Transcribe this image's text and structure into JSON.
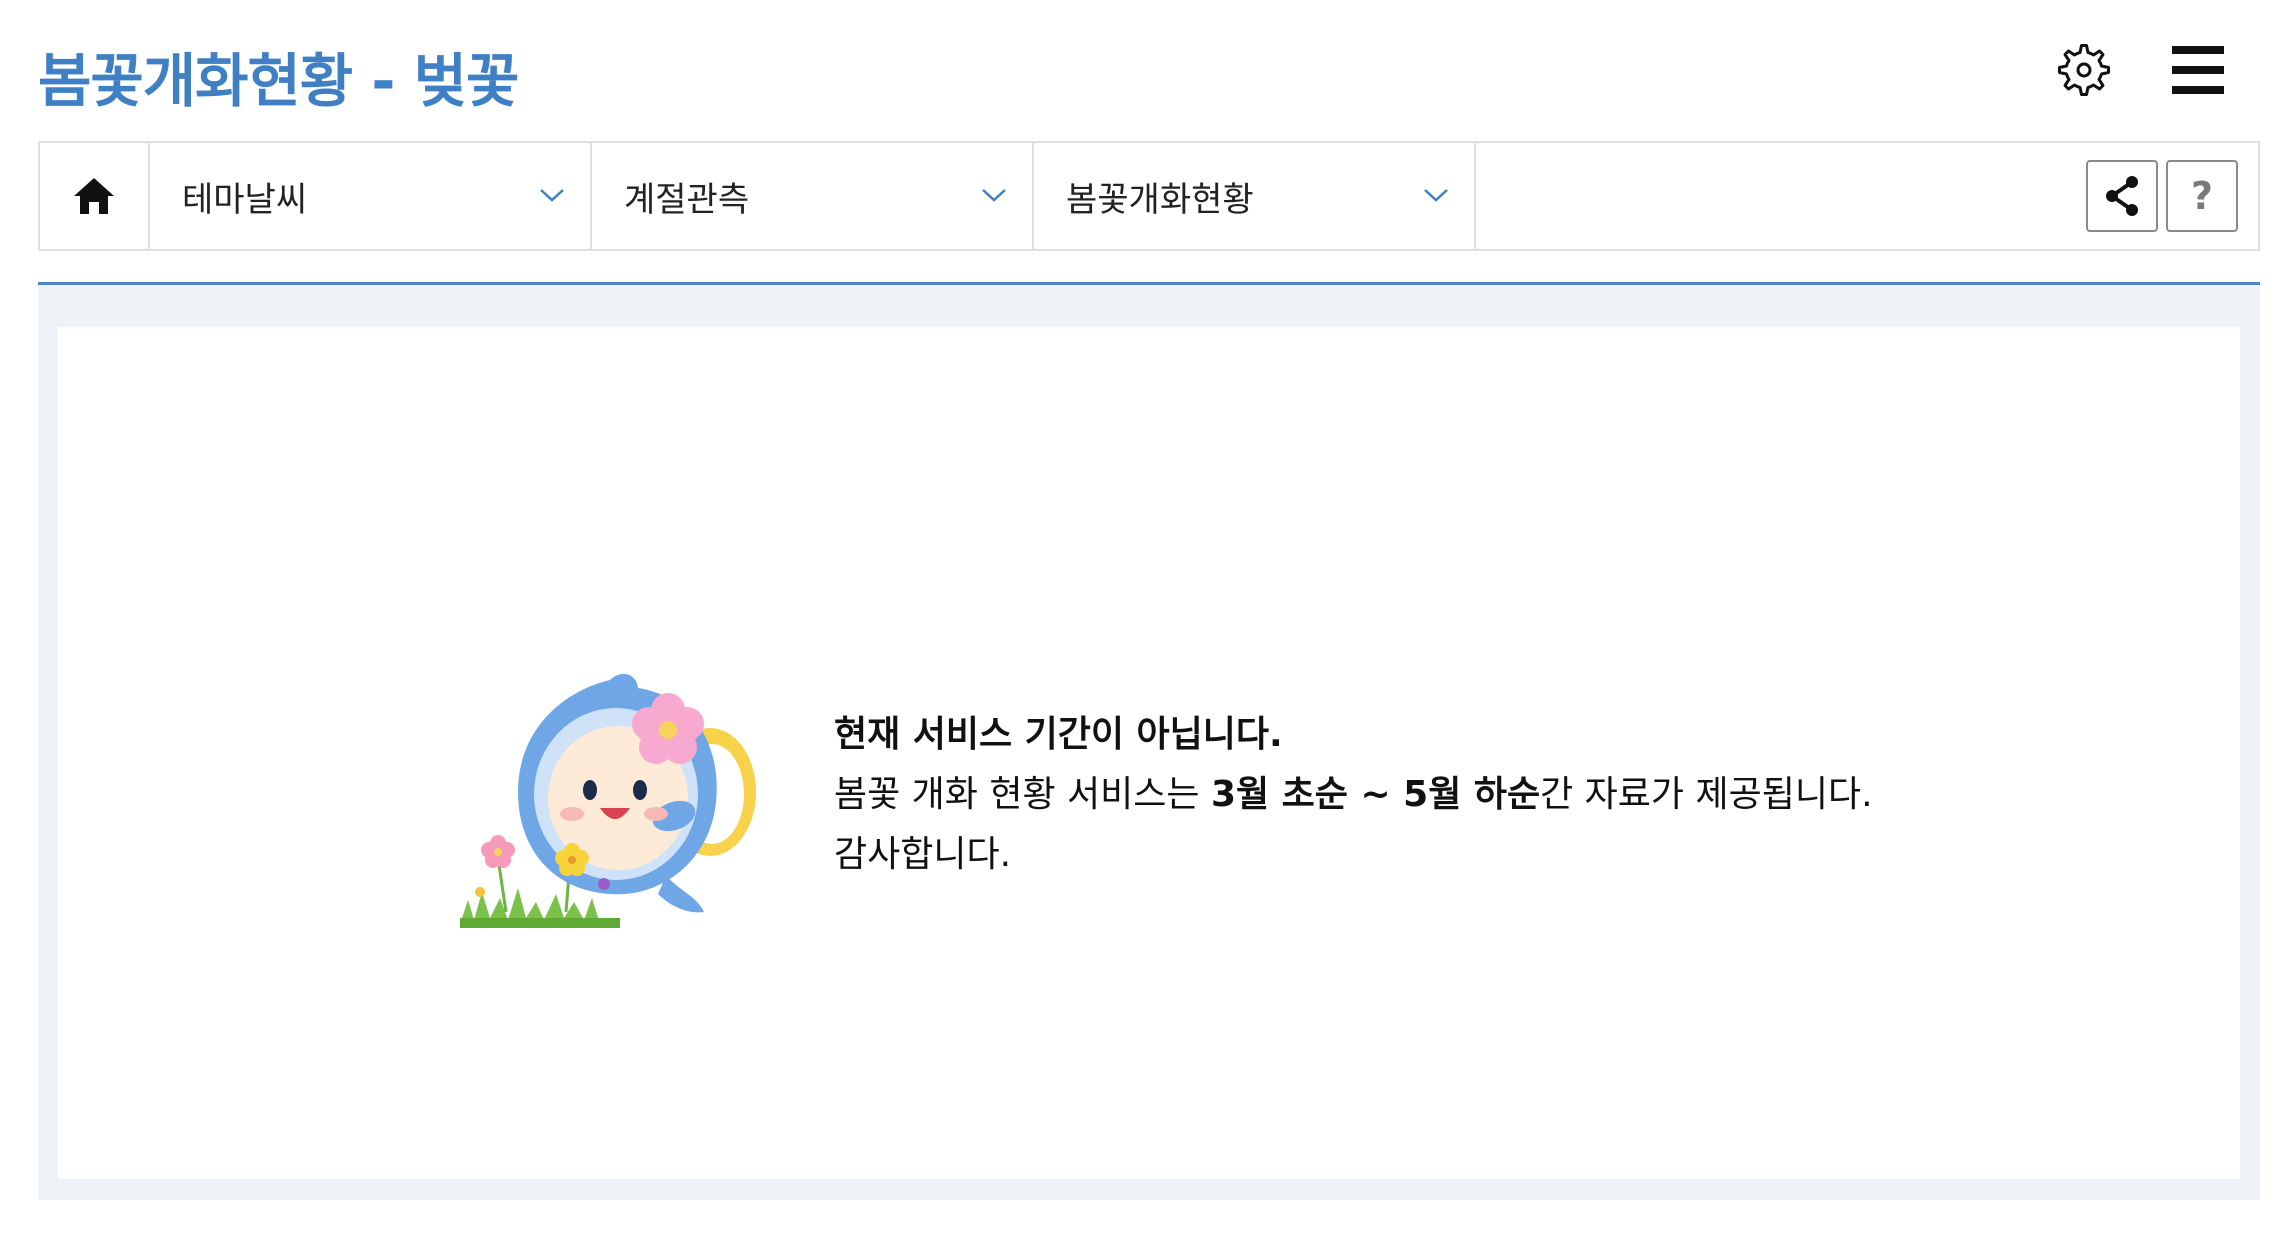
{
  "header": {
    "title": "봄꽃개화현황 - 벚꽃",
    "settings_icon": "gear-icon",
    "menu_icon": "hamburger-menu-icon",
    "title_color": "#3f7fc4"
  },
  "nav": {
    "home_icon": "home-icon",
    "selects": [
      {
        "label": "테마날씨",
        "icon": "chevron-down-icon"
      },
      {
        "label": "계절관측",
        "icon": "chevron-down-icon"
      },
      {
        "label": "봄꽃개화현황",
        "icon": "chevron-down-icon"
      }
    ],
    "share_icon": "share-icon",
    "help_label": "?"
  },
  "notice": {
    "heading": "현재 서비스 기간이 아닙니다.",
    "line2_prefix": "봄꽃 개화 현황 서비스는 ",
    "line2_period": "3월 초순 ~ 5월 하순",
    "line2_suffix": "간 자료가 제공됩니다.",
    "line3": "감사합니다."
  },
  "colors": {
    "accent": "#3f7fc4",
    "divider": "#4d86c6",
    "content_bg": "#eff3f8",
    "border": "#dcdfe4"
  }
}
